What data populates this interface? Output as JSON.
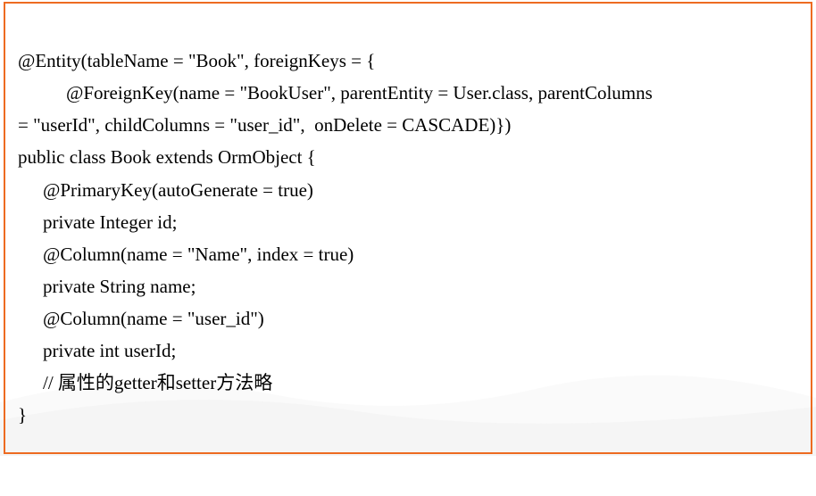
{
  "code": {
    "line1": "@Entity(tableName = \"Book\", foreignKeys = {",
    "line2": "@ForeignKey(name = \"BookUser\", parentEntity = User.class, parentColumns",
    "line3": "= \"userId\", childColumns = \"user_id\",  onDelete = CASCADE)})",
    "line4": "public class Book extends OrmObject {",
    "line5": "@PrimaryKey(autoGenerate = true)",
    "line6": "private Integer id;",
    "line7": "@Column(name = \"Name\", index = true)",
    "line8": "private String name;",
    "line9": "@Column(name = \"user_id\")",
    "line10": "private int userId;",
    "line11": "// 属性的getter和setter方法略",
    "line12": "}"
  }
}
